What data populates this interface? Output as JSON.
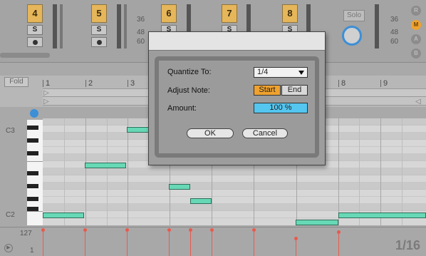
{
  "mixer": {
    "tracks": [
      {
        "number": "4",
        "solo_label": "S"
      },
      {
        "number": "5",
        "solo_label": "S"
      },
      {
        "number": "6",
        "solo_label": "S"
      },
      {
        "number": "7",
        "solo_label": "S"
      },
      {
        "number": "8",
        "solo_label": "S"
      }
    ],
    "db_labels": [
      "36",
      "48",
      "60"
    ],
    "solo_label": "Solo",
    "master_db_labels": [
      "36",
      "48",
      "60"
    ],
    "side_buttons": [
      "R",
      "M",
      "A",
      "B"
    ]
  },
  "piano_roll": {
    "fold_label": "Fold",
    "ruler": [
      "1",
      "2",
      "3",
      "8",
      "9"
    ],
    "pitch_labels": {
      "high": "C3",
      "low": "C2"
    },
    "velocity_label_max": "127",
    "velocity_label_min": "1",
    "grid_resolution": "1/16"
  },
  "dialog": {
    "quantize_label": "Quantize To:",
    "quantize_value": "1/4",
    "adjust_label": "Adjust Note:",
    "adjust_options": [
      "Start",
      "End"
    ],
    "adjust_selected": "Start",
    "amount_label": "Amount:",
    "amount_value": "100 %",
    "ok_label": "OK",
    "cancel_label": "Cancel"
  },
  "colors": {
    "note": "#67d8b5",
    "accent_orange": "#f0a22e",
    "amount_blue": "#54c6f0",
    "velocity": "#e85a4f"
  }
}
